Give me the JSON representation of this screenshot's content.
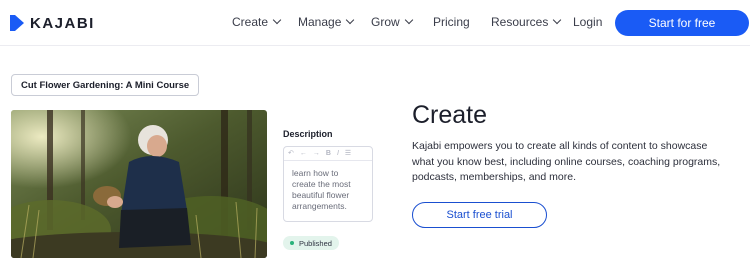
{
  "brand": {
    "name": "KAJABI",
    "color": "#1a5bf5"
  },
  "nav": {
    "create": "Create",
    "manage": "Manage",
    "grow": "Grow",
    "pricing": "Pricing",
    "resources": "Resources",
    "login": "Login",
    "cta": "Start for free"
  },
  "course": {
    "title": "Cut Flower Gardening: A Mini Course",
    "description_label": "Description",
    "description_text": "learn how to create the most beautiful flower arrangements.",
    "toolbar_icons": [
      "undo-icon",
      "arrow-left-icon",
      "arrow-right-icon",
      "bold-icon",
      "italic-icon",
      "list-icon"
    ],
    "status": "Published",
    "status_color": "#2ab27b"
  },
  "hero": {
    "heading": "Create",
    "body": "Kajabi empowers you to create all kinds of content to showcase what you know best, including online courses, coaching programs, podcasts, memberships, and more.",
    "cta": "Start free trial",
    "cta_color": "#1a4fd0"
  }
}
